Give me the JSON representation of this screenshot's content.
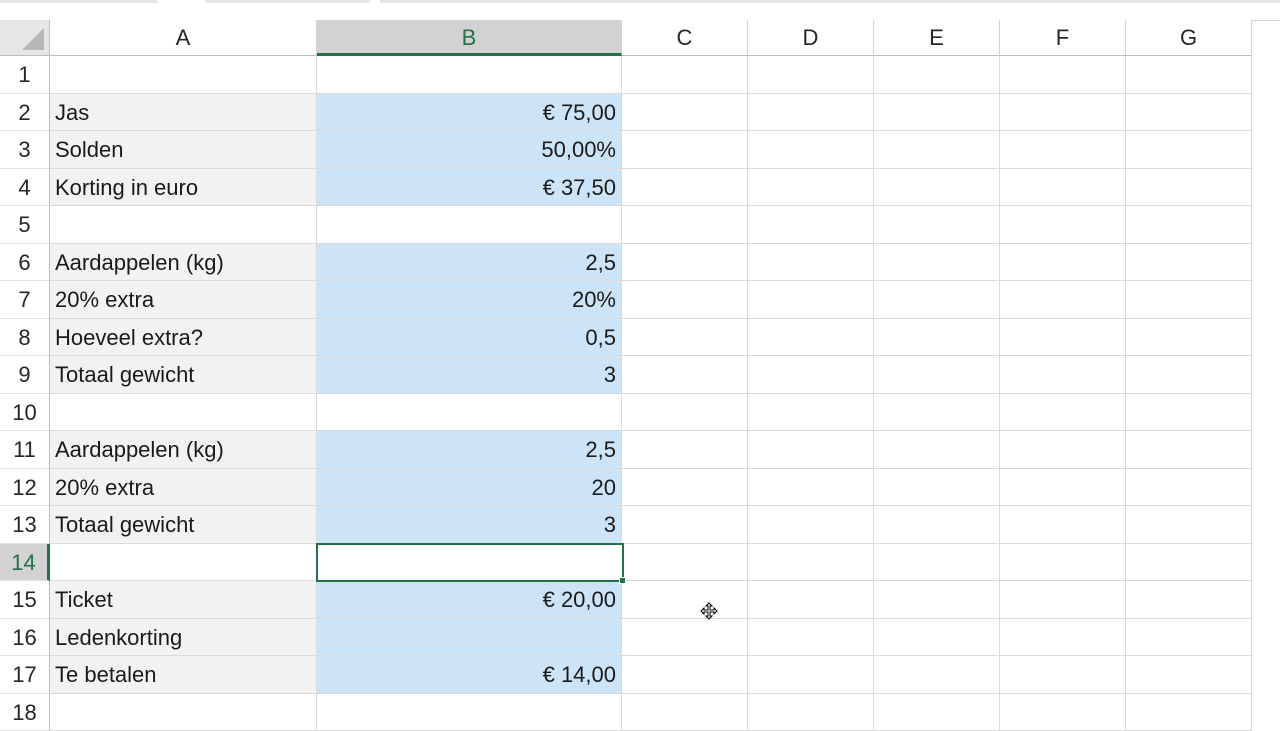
{
  "sheet": {
    "columns": [
      "A",
      "B",
      "C",
      "D",
      "E",
      "F",
      "G"
    ],
    "active_column": "B",
    "active_row": 14,
    "rows": [
      {
        "row": "1",
        "a": "",
        "b": ""
      },
      {
        "row": "2",
        "a": "Jas",
        "b": "€ 75,00"
      },
      {
        "row": "3",
        "a": "Solden",
        "b": "50,00%"
      },
      {
        "row": "4",
        "a": "Korting in euro",
        "b": "€ 37,50"
      },
      {
        "row": "5",
        "a": "",
        "b": ""
      },
      {
        "row": "6",
        "a": "Aardappelen (kg)",
        "b": "2,5"
      },
      {
        "row": "7",
        "a": "20% extra",
        "b": "20%"
      },
      {
        "row": "8",
        "a": "Hoeveel extra?",
        "b": "0,5"
      },
      {
        "row": "9",
        "a": "Totaal gewicht",
        "b": "3"
      },
      {
        "row": "10",
        "a": "",
        "b": ""
      },
      {
        "row": "11",
        "a": "Aardappelen (kg)",
        "b": "2,5"
      },
      {
        "row": "12",
        "a": "20% extra",
        "b": "20"
      },
      {
        "row": "13",
        "a": "Totaal gewicht",
        "b": "3"
      },
      {
        "row": "14",
        "a": "",
        "b": ""
      },
      {
        "row": "15",
        "a": "Ticket",
        "b": "€ 20,00"
      },
      {
        "row": "16",
        "a": "Ledenkorting",
        "b": ""
      },
      {
        "row": "17",
        "a": "Te betalen",
        "b": "€ 14,00"
      },
      {
        "row": "18",
        "a": "",
        "b": ""
      }
    ],
    "filled_rows": [
      2,
      3,
      4,
      6,
      7,
      8,
      9,
      11,
      12,
      13,
      15,
      16,
      17
    ]
  },
  "colors": {
    "accent": "#217346",
    "cell_fill_b": "#cce4f7",
    "cell_fill_a": "#f2f2f2"
  },
  "cursor": {
    "icon": "move-cursor-icon"
  }
}
